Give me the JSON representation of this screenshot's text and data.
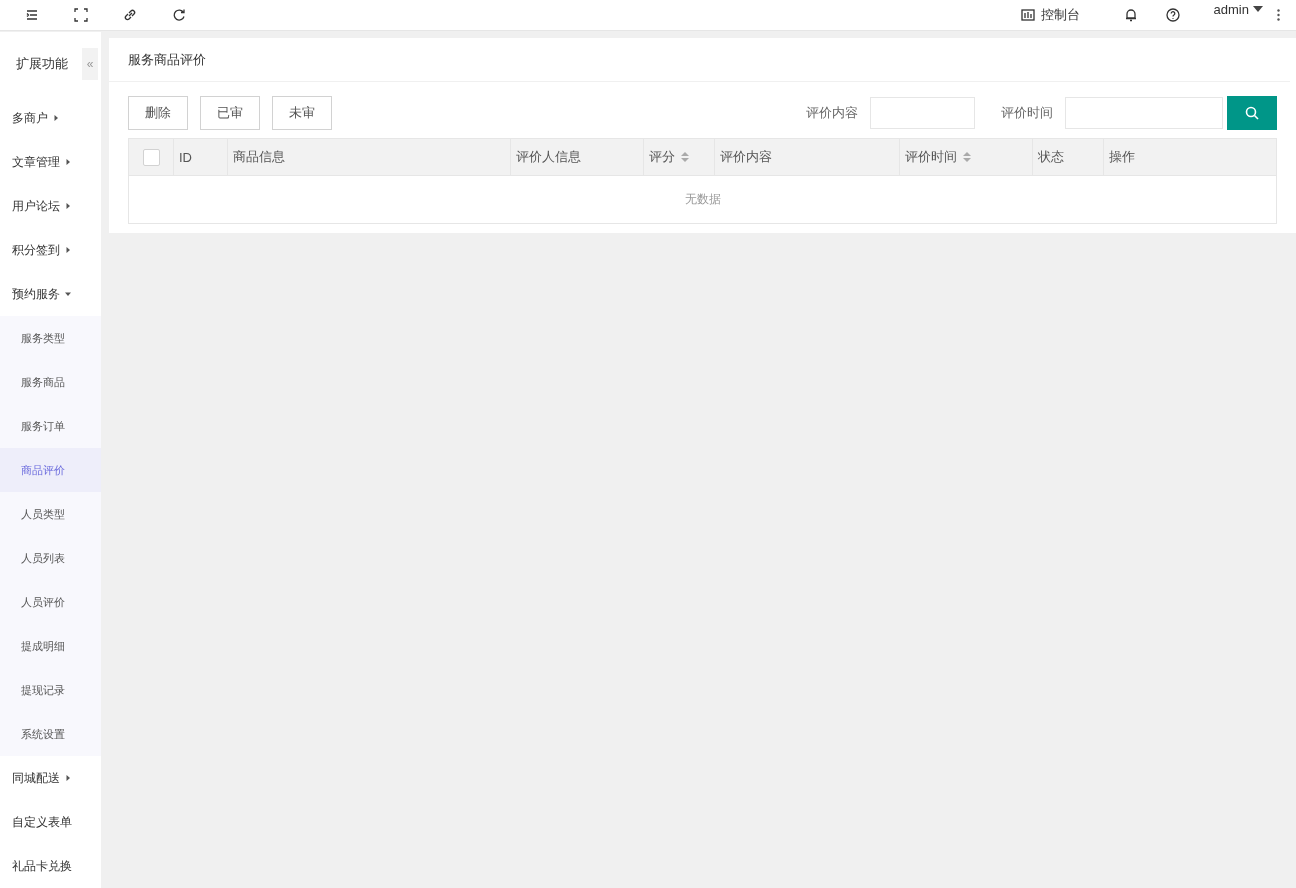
{
  "topbar": {
    "console_label": "控制台",
    "user": "admin"
  },
  "sidebar": {
    "title": "扩展功能",
    "collapse": "«",
    "items": [
      {
        "label": "多商户",
        "kind": "group",
        "expanded": false,
        "selected": false
      },
      {
        "label": "文章管理",
        "kind": "group",
        "expanded": false,
        "selected": false
      },
      {
        "label": "用户论坛",
        "kind": "group",
        "expanded": false,
        "selected": false
      },
      {
        "label": "积分签到",
        "kind": "group",
        "expanded": false,
        "selected": false
      },
      {
        "label": "预约服务",
        "kind": "group",
        "expanded": true,
        "selected": false,
        "children": [
          {
            "label": "服务类型",
            "selected": false
          },
          {
            "label": "服务商品",
            "selected": false
          },
          {
            "label": "服务订单",
            "selected": false
          },
          {
            "label": "商品评价",
            "selected": true
          },
          {
            "label": "人员类型",
            "selected": false
          },
          {
            "label": "人员列表",
            "selected": false
          },
          {
            "label": "人员评价",
            "selected": false
          },
          {
            "label": "提成明细",
            "selected": false
          },
          {
            "label": "提现记录",
            "selected": false
          },
          {
            "label": "系统设置",
            "selected": false
          }
        ]
      },
      {
        "label": "同城配送",
        "kind": "group",
        "expanded": false,
        "selected": false
      },
      {
        "label": "自定义表单",
        "kind": "link",
        "selected": false
      },
      {
        "label": "礼品卡兑换",
        "kind": "link",
        "selected": false
      }
    ]
  },
  "panel": {
    "title": "服务商品评价",
    "buttons": [
      "删除",
      "已审",
      "未审"
    ],
    "filters": [
      {
        "label": "评价内容"
      },
      {
        "label": "评价时间"
      }
    ],
    "table": {
      "select_all_checked": false,
      "columns": [
        {
          "label": "ID",
          "sortable": false
        },
        {
          "label": "商品信息",
          "sortable": false
        },
        {
          "label": "评价人信息",
          "sortable": false
        },
        {
          "label": "评分",
          "sortable": true
        },
        {
          "label": "评价内容",
          "sortable": false
        },
        {
          "label": "评价时间",
          "sortable": true
        },
        {
          "label": "状态",
          "sortable": false
        },
        {
          "label": "操作",
          "sortable": false
        }
      ],
      "empty_text": "无数据"
    }
  }
}
